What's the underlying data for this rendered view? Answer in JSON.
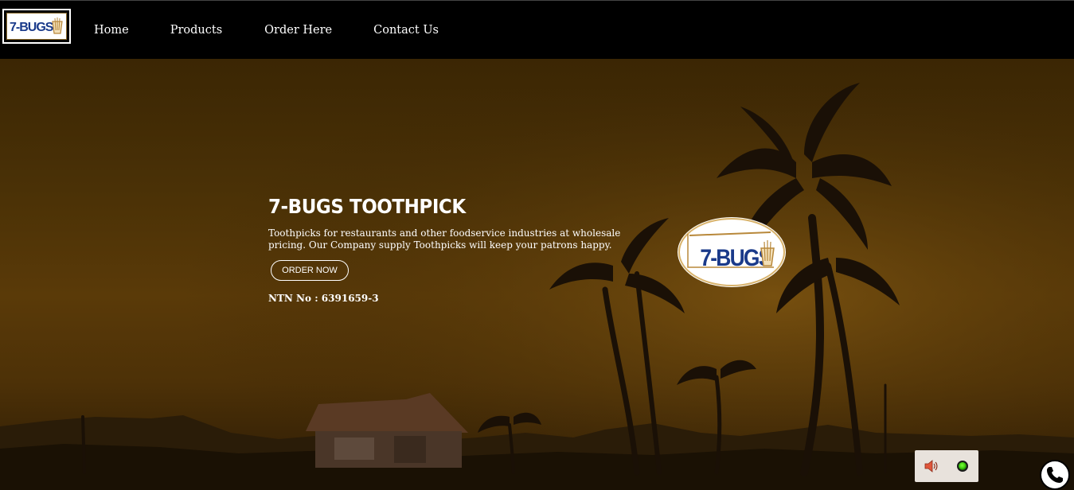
{
  "brand": {
    "logo_text": "7-BUGS"
  },
  "nav": {
    "items": [
      {
        "label": "Home"
      },
      {
        "label": "Products"
      },
      {
        "label": "Order Here"
      },
      {
        "label": "Contact Us"
      }
    ]
  },
  "hero": {
    "title": "7-BUGS TOOTHPICK",
    "description": "Toothpicks for restaurants and other foodservice industries at wholesale pricing. Our Company supply Toothpicks will keep your patrons happy.",
    "cta_label": "ORDER NOW",
    "ntn": "NTN No : 6391659-3",
    "logo_text": "7-BUGS"
  },
  "widgets": {
    "audio_icon": "speaker-icon",
    "status_icon": "status-dot-icon",
    "status_color": "#3fce12",
    "phone_icon": "phone-icon"
  },
  "colors": {
    "navbar_bg": "#000000",
    "logo_blue": "#1a3a8a",
    "logo_gold": "#b8883a",
    "hero_tint": "#4a3106"
  }
}
